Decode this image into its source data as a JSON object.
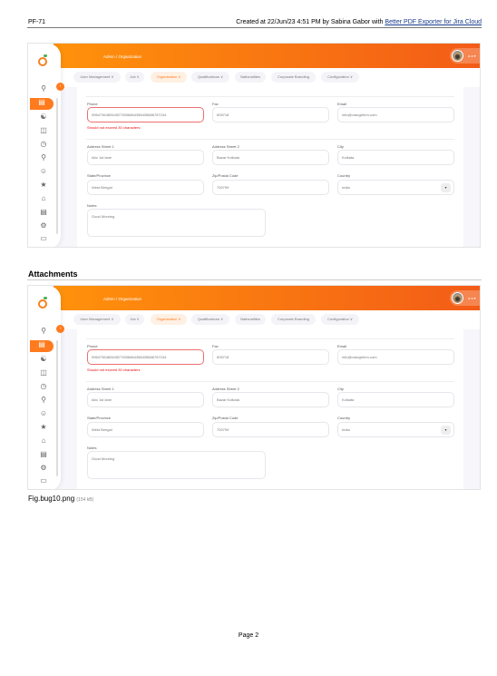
{
  "page_header": {
    "issue_key": "PF-71",
    "created_text": "Created at 22/Jun/23 4:51 PM by Sabina Gabor with ",
    "exporter_link": "Better PDF Exporter for Jira Cloud"
  },
  "section_title": "Attachments",
  "attachment": {
    "filename": "Fig.bug10.png",
    "size": "(154 kB)"
  },
  "page_number": "Page 2",
  "app": {
    "breadcrumb": "Admin / Organization",
    "user_name": "a a ▾",
    "toggle_icon": "›",
    "tabs": [
      {
        "label": "User Management ∨"
      },
      {
        "label": "Job ∨"
      },
      {
        "label": "Organization ∨"
      },
      {
        "label": "Qualifications ∨"
      },
      {
        "label": "Nationalities"
      },
      {
        "label": "Corporate Branding"
      },
      {
        "label": "Configuration ∨"
      }
    ],
    "sidebar_icons": [
      "search",
      "admin",
      "pim",
      "leave",
      "time",
      "recruitment",
      "my-info",
      "performance",
      "dashboard",
      "directory",
      "maintenance",
      "claim"
    ],
    "form": {
      "phone": {
        "label": "Phone",
        "value": "0964736482645273006864358435686767244",
        "error": "Should not exceed 30 characters"
      },
      "fax": {
        "label": "Fax",
        "value": "605718"
      },
      "email": {
        "label": "Email",
        "value": "info@orangehrm.com"
      },
      "street1": {
        "label": "Address Street 1",
        "value": "Abc 1st lane"
      },
      "street2": {
        "label": "Address Street 2",
        "value": "Bazar Kolkata"
      },
      "city": {
        "label": "City",
        "value": "Kolkata"
      },
      "state": {
        "label": "State/Province",
        "value": "West Bengal"
      },
      "zip": {
        "label": "Zip/Postal Code",
        "value": "700799"
      },
      "country": {
        "label": "Country",
        "value": "India",
        "arrow": "▾"
      },
      "notes": {
        "label": "Notes",
        "value": "Good Morning"
      }
    }
  }
}
